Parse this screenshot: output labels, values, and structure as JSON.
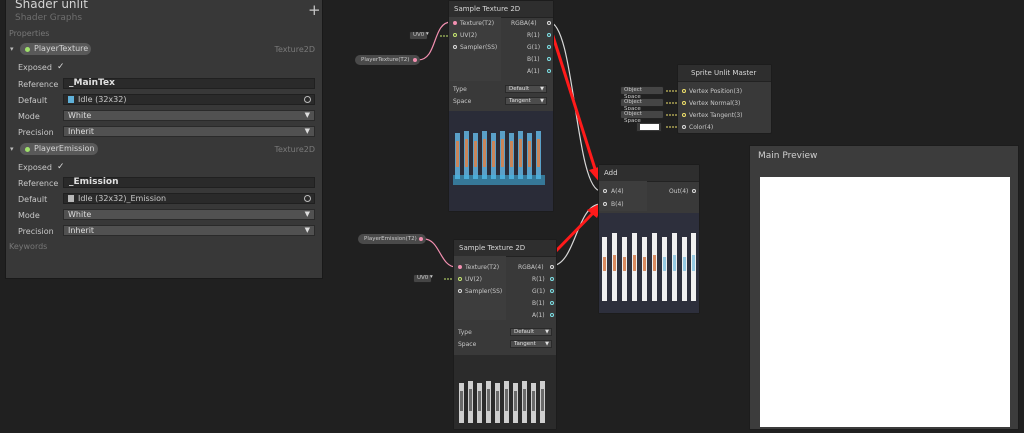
{
  "blackboard": {
    "title": "Shader unlit",
    "subtitle": "Shader Graphs",
    "add_icon": "+",
    "properties_label": "Properties",
    "keywords_label": "Keywords",
    "properties": [
      {
        "name": "PlayerTexture",
        "type": "Texture2D",
        "exposed_label": "Exposed",
        "exposed_check": "✓",
        "reference_label": "Reference",
        "reference": "_MainTex",
        "default_label": "Default",
        "default": "Idle (32x32)",
        "mode_label": "Mode",
        "mode": "White",
        "precision_label": "Precision",
        "precision": "Inherit"
      },
      {
        "name": "PlayerEmission",
        "type": "Texture2D",
        "exposed_label": "Exposed",
        "exposed_check": "✓",
        "reference_label": "Reference",
        "reference": "_Emission",
        "default_label": "Default",
        "default": "Idle (32x32)_Emission",
        "mode_label": "Mode",
        "mode": "White",
        "precision_label": "Precision",
        "precision": "Inherit"
      }
    ]
  },
  "nodes": {
    "sample1": {
      "title": "Sample Texture 2D",
      "inputs": [
        "Texture(T2)",
        "UV(2)",
        "Sampler(SS)"
      ],
      "outputs": [
        "RGBA(4)",
        "R(1)",
        "G(1)",
        "B(1)",
        "A(1)"
      ],
      "type_label": "Type",
      "type_value": "Default",
      "space_label": "Space",
      "space_value": "Tangent",
      "uv_input": "UV0",
      "property_node": "PlayerTexture(T2)"
    },
    "sample2": {
      "title": "Sample Texture 2D",
      "inputs": [
        "Texture(T2)",
        "UV(2)",
        "Sampler(SS)"
      ],
      "outputs": [
        "RGBA(4)",
        "R(1)",
        "G(1)",
        "B(1)",
        "A(1)"
      ],
      "type_label": "Type",
      "type_value": "Default",
      "space_label": "Space",
      "space_value": "Tangent",
      "uv_input": "UV0",
      "property_node": "PlayerEmission(T2)"
    },
    "add": {
      "title": "Add",
      "inputs": [
        "A(4)",
        "B(4)"
      ],
      "outputs": [
        "Out(4)"
      ]
    },
    "master": {
      "title": "Sprite Unlit Master",
      "inputs": [
        "Vertex Position(3)",
        "Vertex Normal(3)",
        "Vertex Tangent(3)",
        "Color(4)"
      ],
      "space_inputs": [
        "Object Space",
        "Object Space",
        "Object Space"
      ]
    }
  },
  "preview": {
    "title": "Main Preview"
  },
  "colors": {
    "annotation": "#ff1a1a",
    "background": "#202020"
  }
}
